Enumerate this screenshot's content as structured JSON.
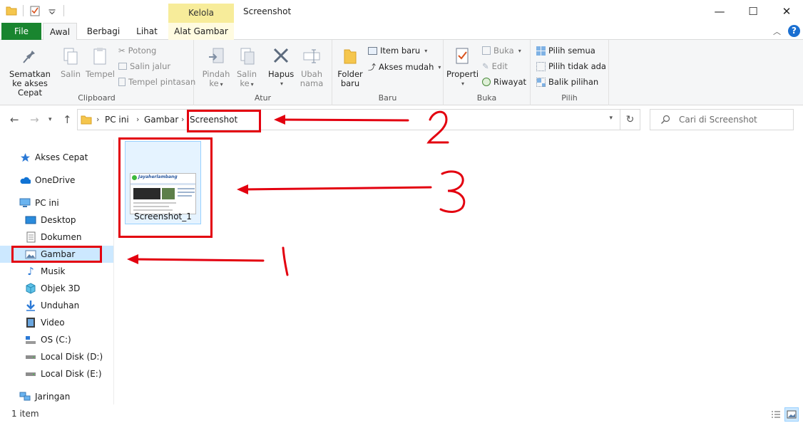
{
  "window": {
    "title": "Screenshot",
    "context_band": "Kelola",
    "minimize": "—",
    "maximize": "☐",
    "close": "✕"
  },
  "tabs": [
    "File",
    "Awal",
    "Berbagi",
    "Lihat",
    "Alat Gambar"
  ],
  "ribbon": {
    "clipboard": {
      "label": "Clipboard",
      "pin": "Sematkan ke akses Cepat",
      "copy": "Salin",
      "paste": "Tempel",
      "cut": "Potong",
      "copy_path": "Salin jalur",
      "paste_shortcut": "Tempel pintasan"
    },
    "atur": {
      "label": "Atur",
      "move": "Pindah ke",
      "copy_to": "Salin ke",
      "delete": "Hapus",
      "rename": "Ubah nama"
    },
    "baru": {
      "label": "Baru",
      "new_folder": "Folder baru",
      "new_item": "Item baru",
      "easy_access": "Akses mudah"
    },
    "buka": {
      "label": "Buka",
      "properties": "Properti",
      "open": "Buka",
      "edit": "Edit",
      "history": "Riwayat"
    },
    "pilih": {
      "label": "Pilih",
      "select_all": "Pilih semua",
      "select_none": "Pilih tidak ada",
      "invert": "Balik pilihan"
    }
  },
  "address": {
    "crumbs": [
      "PC ini",
      "Gambar",
      "Screenshot"
    ]
  },
  "search": {
    "placeholder": "Cari di Screenshot"
  },
  "nav_pane": [
    {
      "label": "Akses Cepat",
      "icon": "star-icon"
    },
    {
      "label": "OneDrive",
      "icon": "cloud-icon"
    },
    {
      "label": "PC ini",
      "icon": "computer-icon"
    },
    {
      "label": "Desktop",
      "icon": "desktop-icon"
    },
    {
      "label": "Dokumen",
      "icon": "document-icon"
    },
    {
      "label": "Gambar",
      "icon": "pictures-icon",
      "selected": true
    },
    {
      "label": "Musik",
      "icon": "music-icon"
    },
    {
      "label": "Objek 3D",
      "icon": "cube-icon"
    },
    {
      "label": "Unduhan",
      "icon": "download-icon"
    },
    {
      "label": "Video",
      "icon": "video-icon"
    },
    {
      "label": "OS (C:)",
      "icon": "os-drive-icon"
    },
    {
      "label": "Local Disk (D:)",
      "icon": "drive-icon"
    },
    {
      "label": "Local Disk (E:)",
      "icon": "drive-icon"
    },
    {
      "label": "Jaringan",
      "icon": "network-icon"
    }
  ],
  "files": [
    {
      "name": "Screenshot_1",
      "thumbnail_caption": "Jayaherlambang"
    }
  ],
  "status": {
    "item_count": "1 item"
  },
  "annotations": {
    "color": "#e3000f",
    "numbers": [
      "2",
      "3",
      "1"
    ]
  },
  "colors": {
    "file_tab": "#19852f",
    "selection": "#cce8ff",
    "context_band": "#f7ec9a"
  }
}
